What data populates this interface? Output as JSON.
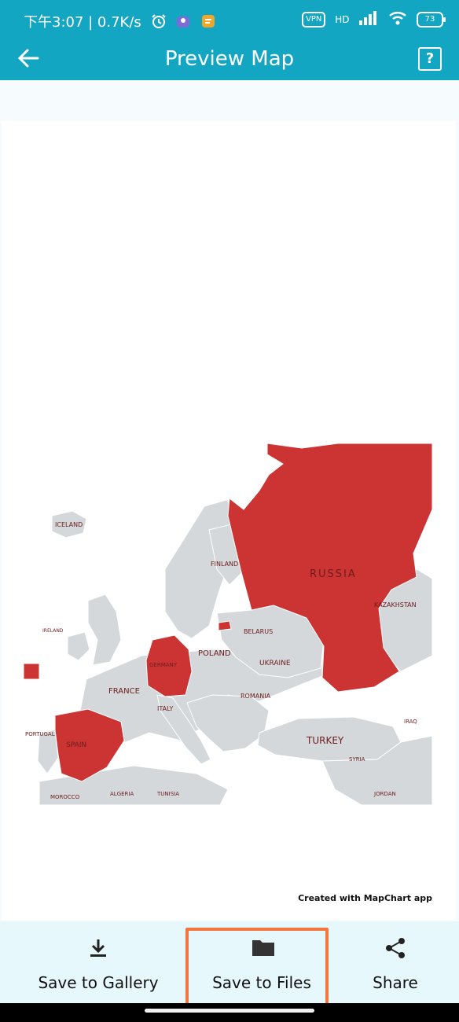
{
  "status_bar": {
    "time_speed": "下午3:07 | 0.7K/s",
    "vpn": "VPN",
    "network": "HD",
    "battery": "73"
  },
  "app_bar": {
    "title": "Preview Map",
    "back_icon": "arrow-left-icon",
    "help_icon": "question-mark-icon",
    "help_label": "?"
  },
  "map": {
    "labels": {
      "russia": "RUSSIA",
      "iceland": "ICELAND",
      "finland": "FINLAND",
      "poland": "POLAND",
      "belarus": "BELARUS",
      "ukraine": "UKRAINE",
      "germany": "GERMANY",
      "france": "FRANCE",
      "italy": "ITALY",
      "spain": "SPAIN",
      "portugal": "PORTUGAL",
      "romania": "ROMANIA",
      "turkey": "TURKEY",
      "kazakhstan": "KAZAKHSTAN",
      "syria": "SYRIA",
      "ireland": "IRELAND",
      "iraq": "IRAQ",
      "algeria": "ALGERIA",
      "tunisia": "TUNISIA",
      "morocco": "MOROCCO",
      "jordan": "JORDAN"
    },
    "colors": {
      "highlight": "#cc3333",
      "land": "#d4d8db"
    },
    "credit": "Created with MapChart app"
  },
  "actions": {
    "save_gallery": "Save to Gallery",
    "save_files": "Save to Files",
    "share": "Share"
  }
}
